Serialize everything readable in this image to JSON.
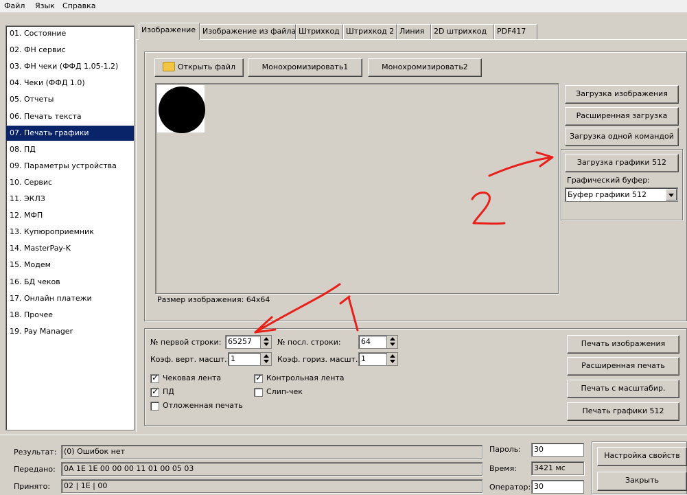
{
  "menu": [
    "Файл",
    "Язык",
    "Справка"
  ],
  "sidebar": {
    "selected_index": 6,
    "items": [
      "01. Состояние",
      "02. ФН сервис",
      "03. ФН чеки (ФФД 1.05-1.2)",
      "04. Чеки (ФФД 1.0)",
      "05. Отчеты",
      "06. Печать текста",
      "07. Печать графики",
      "08. ПД",
      "09. Параметры устройства",
      "10. Сервис",
      "11. ЭКЛЗ",
      "12. МФП",
      "13. Купюроприемник",
      "14. MasterPay-K",
      "15. Модем",
      "16. БД чеков",
      "17. Онлайн платежи",
      "18. Прочее",
      "19. Pay Manager"
    ]
  },
  "tabs": [
    "Изображение",
    "Изображение из файла",
    "Штрихкод",
    "Штрихкод 2",
    "Линия",
    "2D штрихкод",
    "PDF417"
  ],
  "toolbar": {
    "open_file": "Открыть файл",
    "mono1": "Монохромизировать1",
    "mono2": "Монохромизировать2"
  },
  "image_size": "Размер изображения: 64x64",
  "right_buttons": {
    "load_image": "Загрузка изображения",
    "extended_load": "Расширенная загрузка",
    "single_cmd_load": "Загрузка одной командой",
    "load_512": "Загрузка графики 512",
    "buffer_label": "Графический буфер:",
    "buffer_value": "Буфер графики 512"
  },
  "params": {
    "first_line_label": "№ первой строки:",
    "first_line_value": "65257",
    "last_line_label": "№ посл. строки:",
    "last_line_value": "64",
    "vert_scale_label": "Коэф. верт. масшт.:",
    "vert_scale_value": "1",
    "horiz_scale_label": "Коэф. гориз. масшт.:",
    "horiz_scale_value": "1"
  },
  "checkboxes": {
    "receipt_tape": {
      "label": "Чековая лента",
      "checked": true
    },
    "control_tape": {
      "label": "Контрольная лента",
      "checked": true
    },
    "pd": {
      "label": "ПД",
      "checked": true
    },
    "slip": {
      "label": "Слип-чек",
      "checked": false
    },
    "deferred": {
      "label": "Отложенная печать",
      "checked": false
    }
  },
  "print_buttons": {
    "print_image": "Печать изображения",
    "extended_print": "Расширенная печать",
    "print_scaled": "Печать с масштабир.",
    "print_512": "Печать графики 512"
  },
  "status": {
    "result_label": "Результат:",
    "result_value": "(0) Ошибок нет",
    "sent_label": "Передано:",
    "sent_value": "0A 1E 1E 00 00 00 11 01 00 05 03",
    "received_label": "Принято:",
    "received_value": "02 | 1E | 00",
    "password_label": "Пароль:",
    "password_value": "30",
    "time_label": "Время:",
    "time_value": "3421 мс",
    "operator_label": "Оператор:",
    "operator_value": "30",
    "settings_button": "Настройка свойств",
    "close_button": "Закрыть"
  },
  "annotations": {
    "arrow1_label": "1",
    "arrow2_label": "2",
    "color": "#e8201a"
  }
}
